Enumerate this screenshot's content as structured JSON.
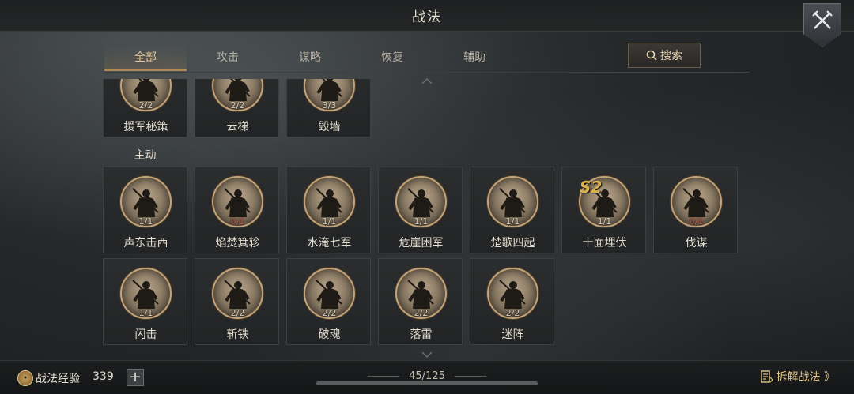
{
  "header": {
    "title": "战法"
  },
  "tabs": [
    {
      "label": "全部",
      "active": true
    },
    {
      "label": "攻击",
      "active": false
    },
    {
      "label": "谋略",
      "active": false
    },
    {
      "label": "恢复",
      "active": false
    },
    {
      "label": "辅助",
      "active": false
    }
  ],
  "search": {
    "label": "搜索",
    "icon": "search-icon"
  },
  "rows_top": [
    {
      "name": "援军秘策",
      "count": "2/2",
      "red": false
    },
    {
      "name": "云梯",
      "count": "2/2",
      "red": false
    },
    {
      "name": "毁墙",
      "count": "3/3",
      "red": false
    }
  ],
  "section": {
    "label": "主动"
  },
  "row_active_1": [
    {
      "name": "声东击西",
      "count": "1/1",
      "red": false,
      "season": ""
    },
    {
      "name": "焰焚箕轸",
      "count": "0/1",
      "red": true,
      "season": ""
    },
    {
      "name": "水淹七军",
      "count": "1/1",
      "red": false,
      "season": ""
    },
    {
      "name": "危崖困军",
      "count": "1/1",
      "red": false,
      "season": ""
    },
    {
      "name": "楚歌四起",
      "count": "1/1",
      "red": false,
      "season": ""
    },
    {
      "name": "十面埋伏",
      "count": "1/1",
      "red": false,
      "season": "S2"
    },
    {
      "name": "伐谋",
      "count": "0/1",
      "red": true,
      "season": ""
    }
  ],
  "row_active_2": [
    {
      "name": "闪击",
      "count": "1/1",
      "red": false
    },
    {
      "name": "斩铁",
      "count": "2/2",
      "red": false
    },
    {
      "name": "破魂",
      "count": "2/2",
      "red": false
    },
    {
      "name": "落雷",
      "count": "2/2",
      "red": false
    },
    {
      "name": "迷阵",
      "count": "2/2",
      "red": false
    }
  ],
  "footer": {
    "exp_label": "战法经验",
    "exp_value": "339",
    "plus": "+",
    "page_count": "45/125",
    "disassemble_label": "拆解战法 》"
  },
  "colors": {
    "accent": "#e6c79a",
    "red_count": "#c9513d",
    "season": "#d9b24a"
  }
}
